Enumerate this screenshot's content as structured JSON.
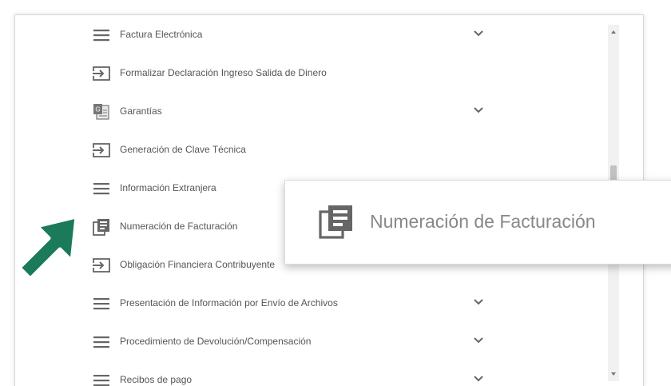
{
  "menu": {
    "items": [
      {
        "label": "Factura Electrónica",
        "icon": "hamburger-icon",
        "expandable": true
      },
      {
        "label": "Formalizar Declaración Ingreso Salida de Dinero",
        "icon": "login-arrow-icon",
        "expandable": false
      },
      {
        "label": "Garantías",
        "icon": "guarantee-document-icon",
        "expandable": true
      },
      {
        "label": "Generación de Clave Técnica",
        "icon": "login-arrow-icon",
        "expandable": false
      },
      {
        "label": "Información Extranjera",
        "icon": "hamburger-icon",
        "expandable": false
      },
      {
        "label": "Numeración de Facturación",
        "icon": "stacked-documents-icon",
        "expandable": false
      },
      {
        "label": "Obligación Financiera Contribuyente",
        "icon": "login-arrow-icon",
        "expandable": false
      },
      {
        "label": "Presentación de Información por Envío de Archivos",
        "icon": "hamburger-icon",
        "expandable": true
      },
      {
        "label": "Procedimiento de Devolución/Compensación",
        "icon": "hamburger-icon",
        "expandable": true
      },
      {
        "label": "Recibos de pago",
        "icon": "hamburger-icon",
        "expandable": true
      }
    ]
  },
  "tooltip": {
    "label": "Numeración de Facturación",
    "icon": "stacked-documents-icon"
  },
  "pointer": {
    "icon": "green-arrow-pointer-icon",
    "color": "#1a7a5a"
  },
  "colors": {
    "icon": "#555555",
    "text": "#555555",
    "tooltip_text": "#888888"
  }
}
